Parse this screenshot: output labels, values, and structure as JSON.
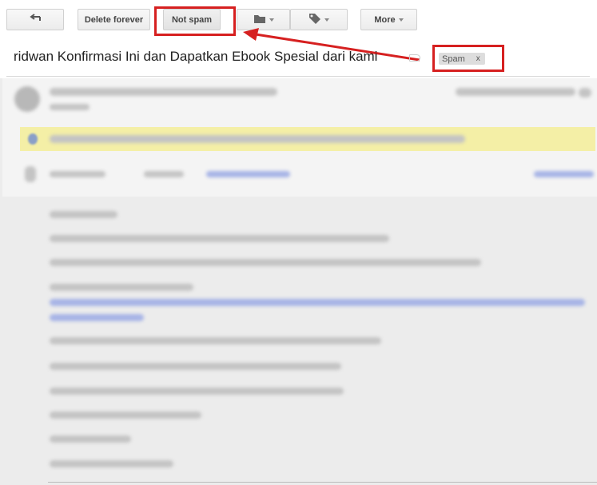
{
  "toolbar": {
    "back_icon": "back-arrow-icon",
    "delete_forever_label": "Delete forever",
    "not_spam_label": "Not spam",
    "move_icon": "folder-icon",
    "labels_icon": "tag-icon",
    "more_label": "More"
  },
  "email": {
    "subject": "ridwan Konfirmasi Ini dan Dapatkan Ebook Spesial dari kami",
    "label_chip": "Spam",
    "label_remove": "x"
  },
  "annotation": {
    "color": "#d62020"
  }
}
